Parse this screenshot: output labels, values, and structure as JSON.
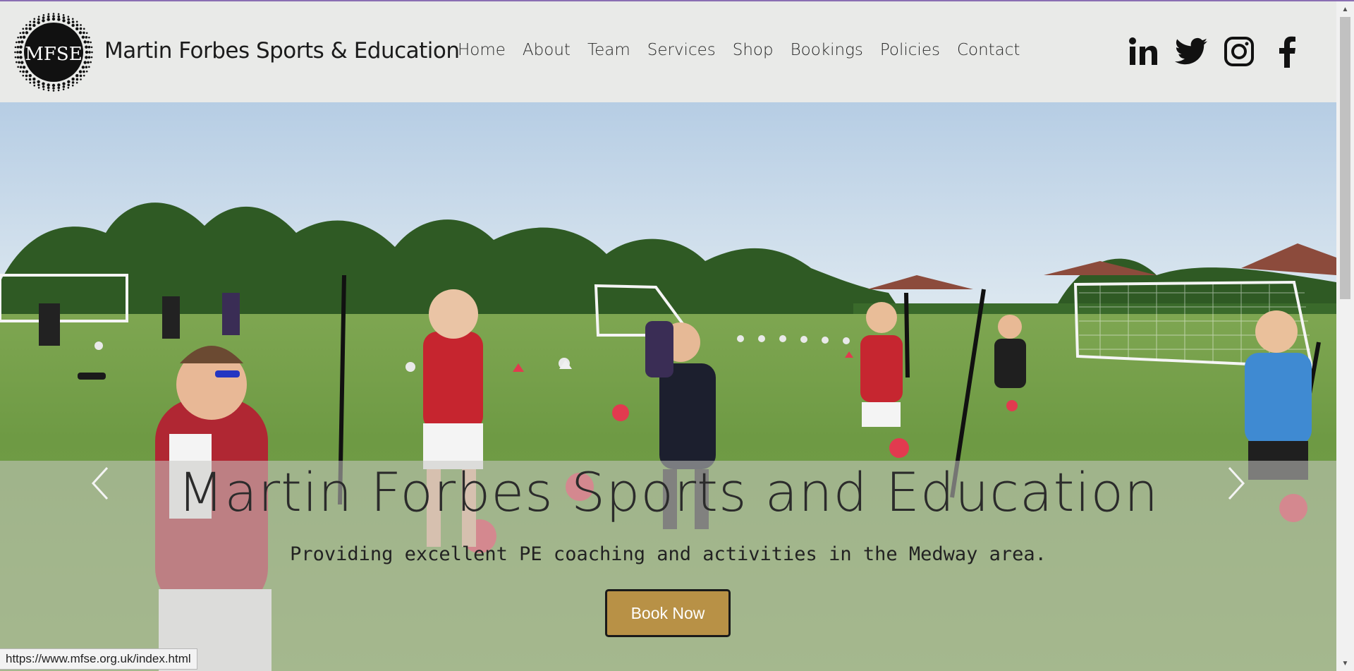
{
  "brand": {
    "logo_text": "MFSE",
    "name": "Martin Forbes Sports & Education"
  },
  "nav": {
    "items": [
      {
        "label": "Home"
      },
      {
        "label": "About"
      },
      {
        "label": "Team"
      },
      {
        "label": "Services"
      },
      {
        "label": "Shop"
      },
      {
        "label": "Bookings"
      },
      {
        "label": "Policies"
      },
      {
        "label": "Contact"
      }
    ]
  },
  "socials": [
    "linkedin-icon",
    "twitter-icon",
    "instagram-icon",
    "facebook-icon"
  ],
  "hero": {
    "title": "Martin Forbes Sports and Education",
    "subtitle": "Providing excellent PE coaching and activities in the Medway area.",
    "cta_label": "Book Now"
  },
  "colors": {
    "cta": "#b89146",
    "header_bg": "#e9eae8",
    "accent_stripe": "#8a6fb3"
  },
  "status_bar": {
    "url": "https://www.mfse.org.uk/index.html"
  }
}
